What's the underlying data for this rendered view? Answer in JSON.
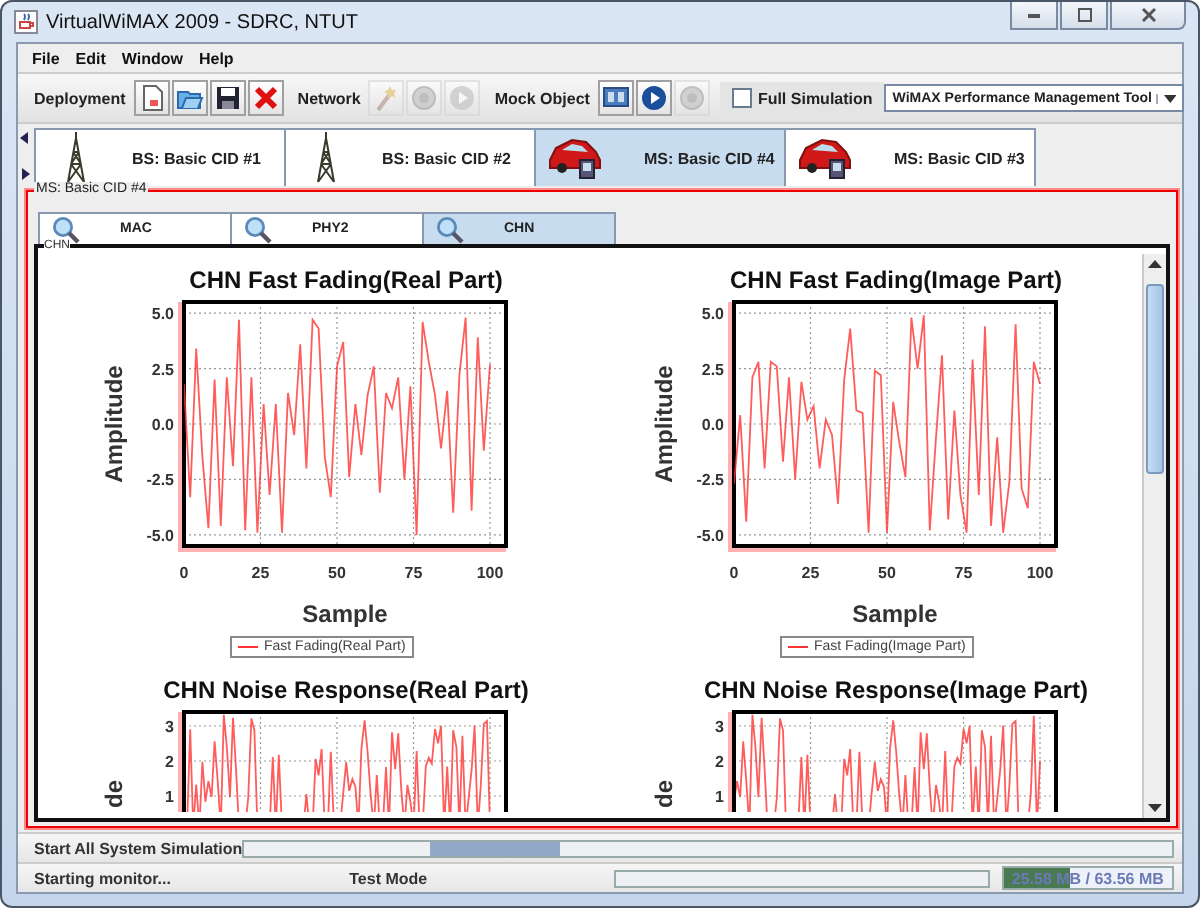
{
  "window": {
    "title": "VirtualWiMAX 2009 - SDRC, NTUT"
  },
  "menu": [
    "File",
    "Edit",
    "Window",
    "Help"
  ],
  "toolbar": {
    "groups": [
      {
        "label": "Deployment",
        "tools": [
          {
            "kind": "new",
            "disabled": false
          },
          {
            "kind": "open",
            "disabled": false
          },
          {
            "kind": "save",
            "disabled": false
          },
          {
            "kind": "delete",
            "disabled": false
          }
        ]
      },
      {
        "label": "Network",
        "tools": [
          {
            "kind": "wizard",
            "disabled": true
          },
          {
            "kind": "record",
            "disabled": true
          },
          {
            "kind": "play",
            "disabled": true
          }
        ]
      },
      {
        "label": "Mock Object",
        "tools": [
          {
            "kind": "monitor",
            "disabled": false
          },
          {
            "kind": "play",
            "disabled": false
          },
          {
            "kind": "record",
            "disabled": true
          }
        ]
      }
    ],
    "full_simulation": {
      "label": "Full Simulation",
      "checked": false
    },
    "tool_select": {
      "value": "WiMAX Performance Management Tool"
    }
  },
  "node_tabs": [
    {
      "kind": "bs",
      "label": "BS: Basic CID #1",
      "selected": false
    },
    {
      "kind": "bs",
      "label": "BS: Basic CID #2",
      "selected": false
    },
    {
      "kind": "ms",
      "label": "MS: Basic CID #4",
      "selected": true
    },
    {
      "kind": "ms",
      "label": "MS: Basic CID #3",
      "selected": false
    }
  ],
  "panel": {
    "title": "MS: Basic CID #4",
    "tabs": [
      {
        "label": "MAC",
        "selected": false
      },
      {
        "label": "PHY2",
        "selected": false
      },
      {
        "label": "CHN",
        "selected": true
      }
    ],
    "section": "CHN",
    "charts": [
      {
        "kind": "chart",
        "chart_data": {
          "type": "line",
          "grid": true,
          "title": "CHN Fast Fading(Real Part)",
          "xlabel": "Sample",
          "ylabel": "Amplitude",
          "xlim": [
            0,
            100
          ],
          "ylim": [
            -5.5,
            5.5
          ],
          "xticks": [
            0,
            25,
            50,
            75,
            100
          ],
          "yticks": [
            {
              "value": 5,
              "label": "5.0"
            },
            {
              "value": 2.5,
              "label": "2.5"
            },
            {
              "value": 0,
              "label": "0.0"
            },
            {
              "value": -2.5,
              "label": "-2.5"
            },
            {
              "value": -5,
              "label": "-5.0"
            }
          ],
          "x": [
            0,
            2,
            4,
            6,
            8,
            10,
            12,
            14,
            16,
            18,
            20,
            22,
            24,
            26,
            28,
            30,
            32,
            34,
            36,
            38,
            40,
            42,
            44,
            46,
            48,
            50,
            52,
            54,
            56,
            58,
            60,
            62,
            64,
            66,
            68,
            70,
            72,
            74,
            76,
            78,
            80,
            82,
            84,
            86,
            88,
            90,
            92,
            94,
            96,
            98,
            100
          ],
          "series": [
            {
              "name": "Fast Fading(Real Part)",
              "color": "#ff3333",
              "values": [
                1.8,
                -3.3,
                3.4,
                -1.5,
                -4.7,
                2.0,
                -4.6,
                2.1,
                -1.9,
                4.7,
                -4.8,
                2.1,
                -4.9,
                0.9,
                -3.2,
                0.9,
                -4.9,
                1.4,
                -0.5,
                3.6,
                -2.0,
                4.7,
                4.3,
                -1.5,
                -3.3,
                2.6,
                3.7,
                -2.4,
                0.9,
                -1.4,
                1.3,
                2.6,
                -3.1,
                1.4,
                0.7,
                2.1,
                -2.5,
                1.7,
                -5.0,
                4.6,
                2.8,
                1.3,
                -1.1,
                1.5,
                -4.0,
                2.2,
                4.8,
                -3.9,
                3.9,
                -1.2,
                2.7
              ]
            }
          ]
        }
      },
      {
        "kind": "chart",
        "chart_data": {
          "type": "line",
          "grid": true,
          "title": "CHN Fast Fading(Image Part)",
          "xlabel": "Sample",
          "ylabel": "Amplitude",
          "xlim": [
            0,
            100
          ],
          "ylim": [
            -5.5,
            5.5
          ],
          "xticks": [
            0,
            25,
            50,
            75,
            100
          ],
          "yticks": [
            {
              "value": 5,
              "label": "5.0"
            },
            {
              "value": 2.5,
              "label": "2.5"
            },
            {
              "value": 0,
              "label": "0.0"
            },
            {
              "value": -2.5,
              "label": "-2.5"
            },
            {
              "value": -5,
              "label": "-5.0"
            }
          ],
          "x": [
            0,
            2,
            4,
            6,
            8,
            10,
            12,
            14,
            16,
            18,
            20,
            22,
            24,
            26,
            28,
            30,
            32,
            34,
            36,
            38,
            40,
            42,
            44,
            46,
            48,
            50,
            52,
            54,
            56,
            58,
            60,
            62,
            64,
            66,
            68,
            70,
            72,
            74,
            76,
            78,
            80,
            82,
            84,
            86,
            88,
            90,
            92,
            94,
            96,
            98,
            100
          ],
          "series": [
            {
              "name": "Fast Fading(Image Part)",
              "color": "#ff3333",
              "values": [
                -2.7,
                0.4,
                -4.4,
                2.1,
                2.8,
                -2.0,
                2.8,
                2.6,
                -1.7,
                2.1,
                -2.5,
                1.9,
                0.2,
                0.8,
                -2.0,
                0.2,
                -0.5,
                -3.6,
                2.0,
                4.3,
                0.6,
                0.5,
                -4.9,
                2.4,
                2.2,
                -4.9,
                1.0,
                -0.8,
                -2.4,
                4.8,
                2.5,
                4.9,
                -4.8,
                -0.6,
                3.1,
                -4.3,
                0.6,
                -3.2,
                -4.9,
                2.9,
                -3.2,
                4.4,
                -4.6,
                -0.6,
                -4.9,
                -2.6,
                4.5,
                -2.9,
                -3.8,
                2.8,
                1.8
              ]
            }
          ]
        }
      },
      {
        "kind": "waveform",
        "title": "CHN Noise Response(Real Part)",
        "ylabel": "de",
        "yticks": [
          "3",
          "2",
          "1"
        ]
      },
      {
        "kind": "waveform",
        "title": "CHN Noise Response(Image Part)",
        "ylabel": "de",
        "yticks": [
          "3",
          "2",
          "1"
        ]
      }
    ]
  },
  "status": {
    "task": "Start All System Simulation",
    "task_active": true,
    "progress": {
      "level": 0
    },
    "message": "Starting monitor...",
    "mode": "Test Mode",
    "memory": {
      "text": "25.58 MB / 63.56 MB",
      "level": 0.4
    }
  }
}
